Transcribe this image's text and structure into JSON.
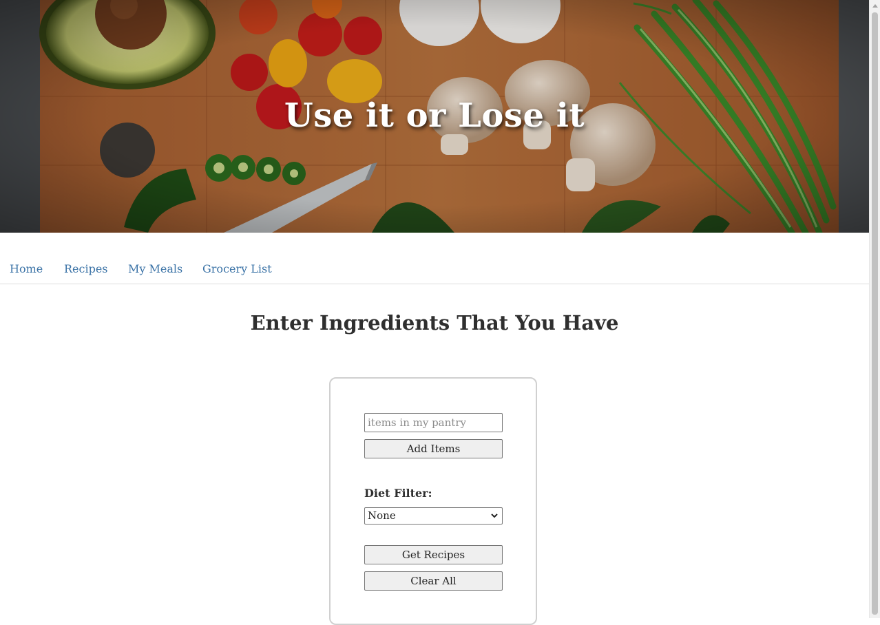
{
  "hero": {
    "title": "Use it or Lose it"
  },
  "nav": {
    "items": [
      {
        "label": "Home"
      },
      {
        "label": "Recipes"
      },
      {
        "label": "My Meals"
      },
      {
        "label": "Grocery List"
      }
    ]
  },
  "main": {
    "heading": "Enter Ingredients That You Have",
    "pantry_input": {
      "placeholder": "items in my pantry",
      "value": ""
    },
    "add_items_label": "Add Items",
    "diet_filter": {
      "label": "Diet Filter:",
      "selected": "None"
    },
    "get_recipes_label": "Get Recipes",
    "clear_all_label": "Clear All"
  },
  "colors": {
    "nav_link": "#3a72a6",
    "heading_text": "#2f2f2f",
    "button_bg": "#efefef",
    "card_border": "#d0d0d0",
    "hero_board": "#b06a3a"
  }
}
